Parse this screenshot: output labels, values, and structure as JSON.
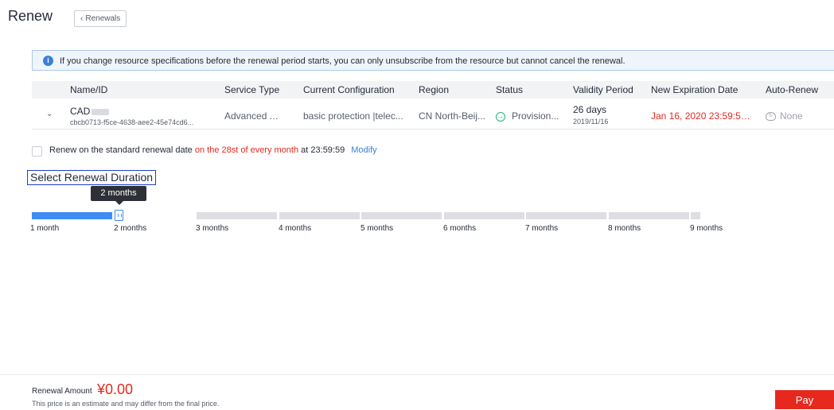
{
  "header": {
    "title": "Renew",
    "back_label": "Renewals",
    "back_icon": "chevron-left-icon"
  },
  "notice": {
    "icon": "info-icon",
    "text": "If you change resource specifications before the renewal period starts, you can only unsubscribe from the resource but cannot cancel the renewal."
  },
  "table": {
    "columns": [
      "Name/ID",
      "Service Type",
      "Current Configuration",
      "Region",
      "Status",
      "Validity Period",
      "New Expiration Date",
      "Auto-Renew"
    ],
    "rows": [
      {
        "name": "CAD",
        "id": "cbcb0713-f5ce-4638-aee2-45e74cd6...",
        "service_type": "Advanced An...",
        "configuration": "basic protection |telec...",
        "region": "CN North-Beij...",
        "status": "Provision...",
        "validity_days": "26 days",
        "validity_date": "2019/11/16",
        "new_expiration": "Jan 16, 2020 23:59:59 ...",
        "auto_renew": "None"
      }
    ]
  },
  "standard_renewal": {
    "checked": false,
    "prefix": "Renew on the standard renewal date",
    "highlight": "on the 28st of every month",
    "suffix": "at 23:59:59",
    "modify_label": "Modify"
  },
  "duration": {
    "section_title": "Select Renewal Duration",
    "selected_label": "2 months",
    "selected_index": 1,
    "ticks": [
      "1 month",
      "2 months",
      "3 months",
      "4 months",
      "5 months",
      "6 months",
      "7 months",
      "8 months",
      "9 months"
    ]
  },
  "footer": {
    "amount_label": "Renewal Amount",
    "amount_value": "¥0.00",
    "estimate_note": "This price is an estimate and may differ from the final price.",
    "pay_label": "Pay"
  },
  "colors": {
    "accent": "#3f8cf5",
    "danger": "#e6281e",
    "link": "#3a7fd5",
    "success": "#27b37a"
  }
}
